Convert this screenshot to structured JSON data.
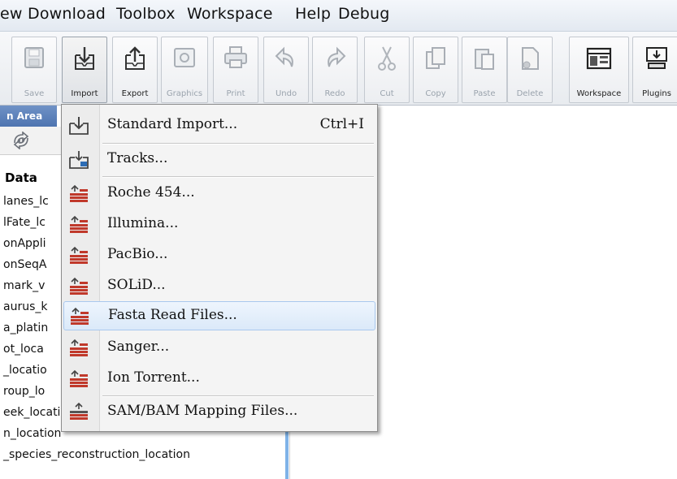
{
  "menubar": {
    "items": [
      "ew",
      "Download",
      "Toolbox",
      "Workspace",
      "Help",
      "Debug"
    ]
  },
  "toolbar": {
    "buttons": [
      {
        "label": "Save",
        "icon": "save-icon",
        "enabled": false
      },
      {
        "label": "Import",
        "icon": "import-icon",
        "enabled": true
      },
      {
        "label": "Export",
        "icon": "export-icon",
        "enabled": true
      },
      {
        "label": "Graphics",
        "icon": "graphics-icon",
        "enabled": false
      },
      {
        "label": "Print",
        "icon": "print-icon",
        "enabled": false
      },
      {
        "label": "Undo",
        "icon": "undo-icon",
        "enabled": false
      },
      {
        "label": "Redo",
        "icon": "redo-icon",
        "enabled": false
      },
      {
        "label": "Cut",
        "icon": "cut-icon",
        "enabled": false
      },
      {
        "label": "Copy",
        "icon": "copy-icon",
        "enabled": false
      },
      {
        "label": "Paste",
        "icon": "paste-icon",
        "enabled": false
      },
      {
        "label": "Delete",
        "icon": "delete-icon",
        "enabled": false
      },
      {
        "label": "Workspace",
        "icon": "workspace-icon",
        "enabled": true
      },
      {
        "label": "Plugins",
        "icon": "plugins-icon",
        "enabled": true
      }
    ]
  },
  "left_panel": {
    "tab_label": "n Area",
    "root_label": "Data",
    "items": [
      "lanes_lc",
      "lFate_lc",
      "onAppli",
      "onSeqA",
      "mark_v",
      "aurus_k",
      "a_platin",
      "ot_loca",
      "_locatio",
      "roup_lo",
      "eek_location",
      "n_location",
      "_species_reconstruction_location"
    ]
  },
  "dropdown": {
    "items": [
      {
        "label": "Standard Import...",
        "shortcut": "Ctrl+I",
        "icon": "standard-import-icon"
      },
      {
        "label": "Tracks...",
        "icon": "tracks-icon"
      },
      {
        "label": "Roche 454...",
        "icon": "reads-import-icon"
      },
      {
        "label": "Illumina...",
        "icon": "reads-import-icon"
      },
      {
        "label": "PacBio...",
        "icon": "reads-import-icon"
      },
      {
        "label": "SOLiD...",
        "icon": "reads-import-icon"
      },
      {
        "label": "Fasta Read Files...",
        "icon": "reads-import-icon",
        "highlighted": true
      },
      {
        "label": "Sanger...",
        "icon": "reads-import-icon"
      },
      {
        "label": "Ion Torrent...",
        "icon": "reads-import-icon"
      },
      {
        "label": "SAM/BAM Mapping Files...",
        "icon": "mapping-import-icon"
      }
    ]
  },
  "colors": {
    "highlight": "#dbe9f9",
    "panel_tab": "#5a7fb9",
    "divider": "#7fb3e8",
    "reads_icon": "#c0392b"
  }
}
